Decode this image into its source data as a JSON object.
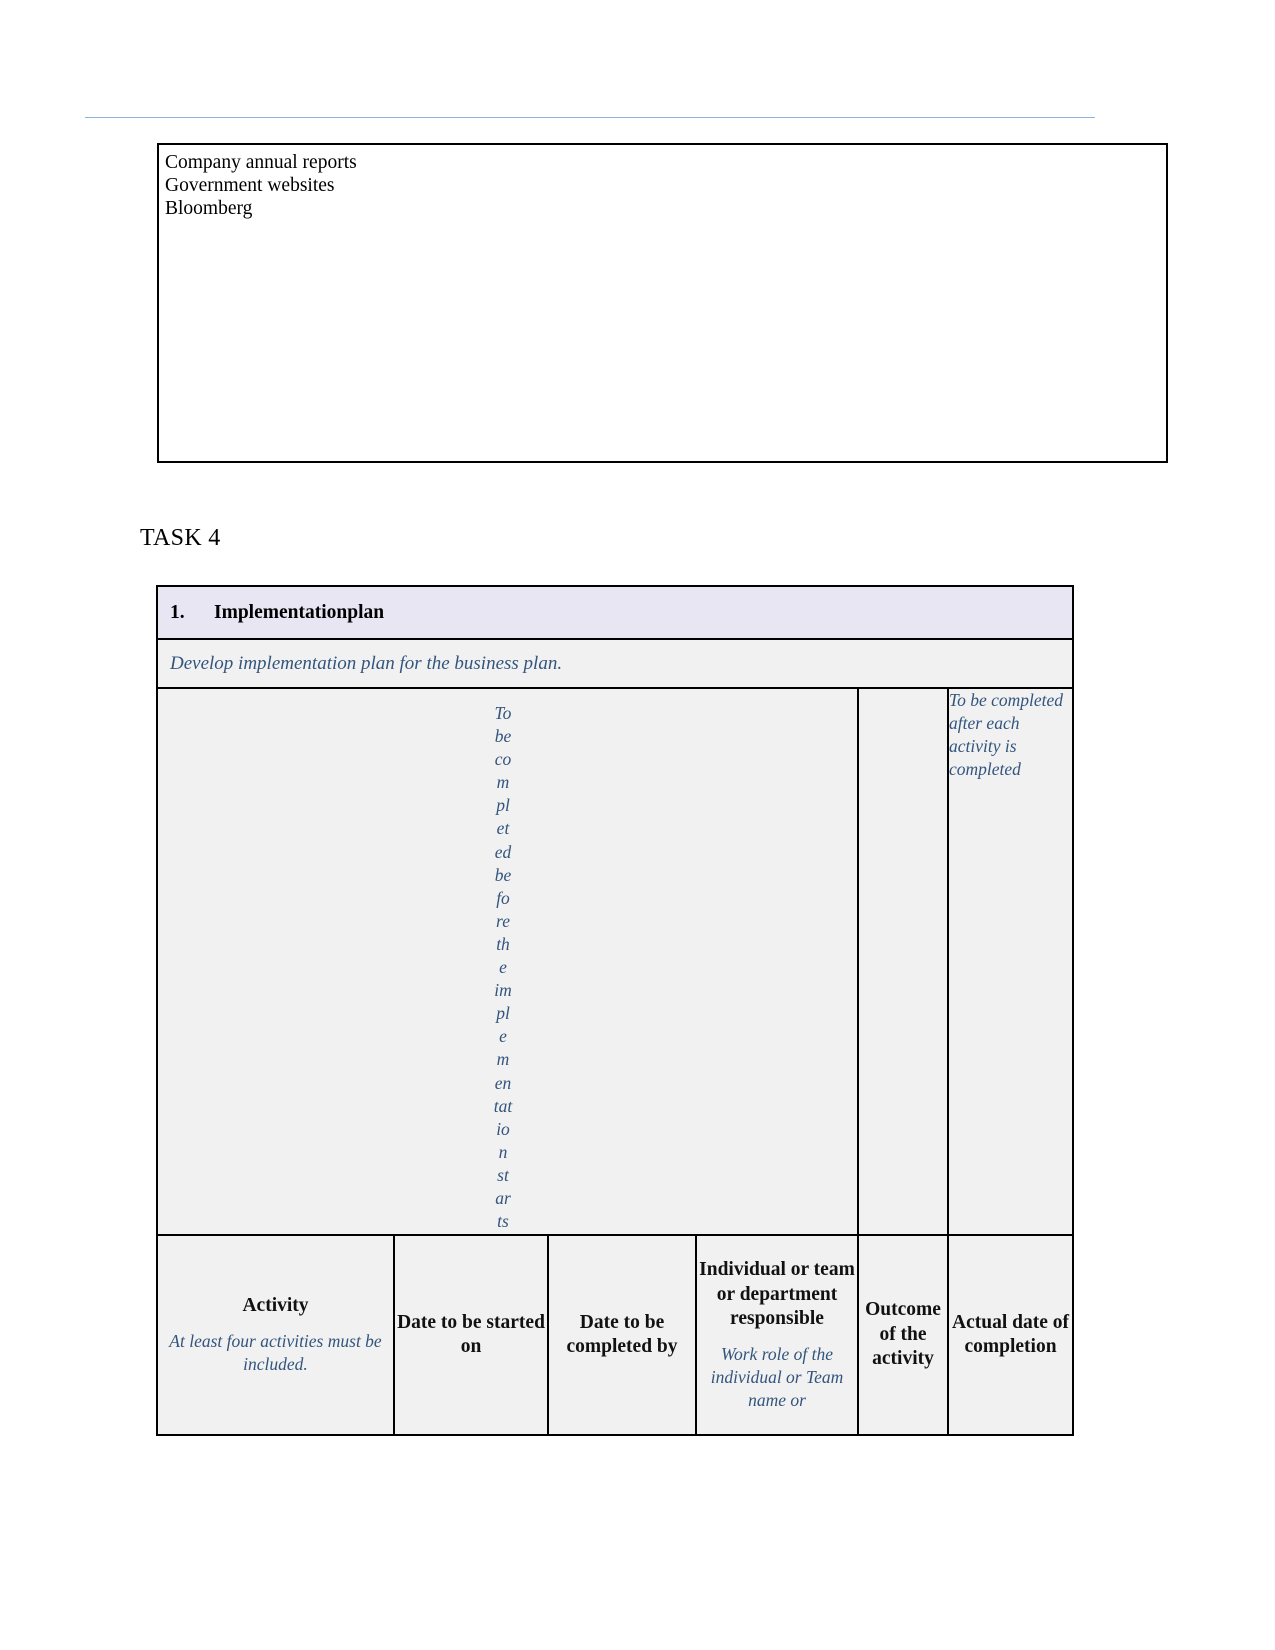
{
  "document": {
    "top_box": {
      "lines": [
        "Company annual reports",
        "Government websites",
        "Bloomberg"
      ]
    },
    "task_heading": "TASK 4",
    "plan_table": {
      "title_number": "1.",
      "title": "Implementationplan",
      "instruction": "Develop implementation plan for the business plan.",
      "band": {
        "narrow_column_text": "To be completed before the implementation starts",
        "narrow_column_fragments": [
          "To",
          "be",
          "co",
          "m",
          "pl",
          "et",
          "ed",
          "be",
          "fo",
          "re",
          "th",
          "e",
          "im",
          "pl",
          "e",
          "m",
          "en",
          "tat",
          "io",
          "n",
          "st",
          "ar",
          "ts"
        ],
        "right_column_text": "To be completed after each activity is completed"
      },
      "columns": [
        {
          "header": "Activity",
          "sub": "At least four activities must be included."
        },
        {
          "header": "Date to be started on",
          "sub": ""
        },
        {
          "header": "Date to be completed by",
          "sub": ""
        },
        {
          "header": "Individual or team or department responsible",
          "sub": "Work role of the individual or Team name or"
        },
        {
          "header": "Outcome of the activity",
          "sub": ""
        },
        {
          "header": "Actual date of completion",
          "sub": ""
        }
      ]
    }
  },
  "colors": {
    "header_rule": "#8fb4d9",
    "title_row_bg": "#e8e6f3",
    "cell_bg": "#f1f1f1",
    "italic_blue": "#33557d",
    "border": "#000000"
  }
}
